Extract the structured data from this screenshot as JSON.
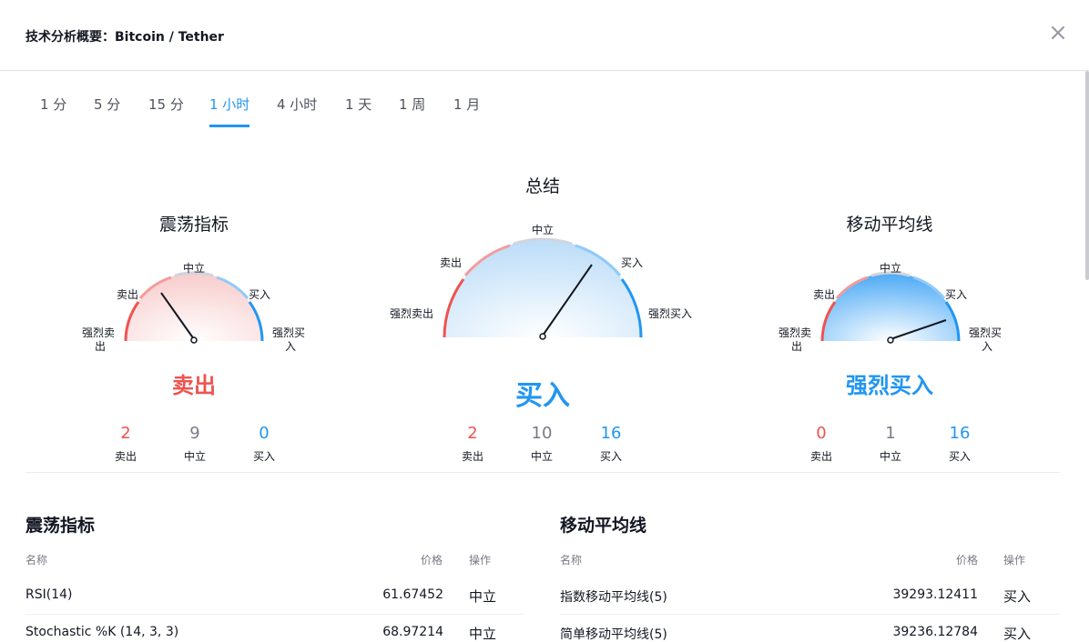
{
  "header": {
    "title": "技术分析概要：Bitcoin / Tether"
  },
  "tabs": [
    {
      "label": "1 分",
      "active": false
    },
    {
      "label": "5 分",
      "active": false
    },
    {
      "label": "15 分",
      "active": false
    },
    {
      "label": "1 小时",
      "active": true
    },
    {
      "label": "4 小时",
      "active": false
    },
    {
      "label": "1 天",
      "active": false
    },
    {
      "label": "1 周",
      "active": false
    },
    {
      "label": "1 月",
      "active": false
    }
  ],
  "gauges": {
    "oscillators": {
      "title": "震荡指标",
      "labels": {
        "strong_sell": "强烈卖出",
        "sell": "卖出",
        "neutral": "中立",
        "buy": "买入",
        "strong_buy": "强烈买入"
      },
      "verdict": "卖出",
      "counts": [
        {
          "value": "2",
          "label": "卖出"
        },
        {
          "value": "9",
          "label": "中立"
        },
        {
          "value": "0",
          "label": "买入"
        }
      ]
    },
    "summary": {
      "title": "总结",
      "labels": {
        "strong_sell": "强烈卖出",
        "sell": "卖出",
        "neutral": "中立",
        "buy": "买入",
        "strong_buy": "强烈买入"
      },
      "verdict": "买入",
      "counts": [
        {
          "value": "2",
          "label": "卖出"
        },
        {
          "value": "10",
          "label": "中立"
        },
        {
          "value": "16",
          "label": "买入"
        }
      ]
    },
    "moving_averages": {
      "title": "移动平均线",
      "labels": {
        "strong_sell": "强烈卖出",
        "sell": "卖出",
        "neutral": "中立",
        "buy": "买入",
        "strong_buy": "强烈买入"
      },
      "verdict": "强烈买入",
      "counts": [
        {
          "value": "0",
          "label": "卖出"
        },
        {
          "value": "1",
          "label": "中立"
        },
        {
          "value": "16",
          "label": "买入"
        }
      ]
    }
  },
  "oscillators_table": {
    "title": "震荡指标",
    "columns": {
      "name": "名称",
      "price": "价格",
      "action": "操作"
    },
    "rows": [
      {
        "name": "RSI(14)",
        "price": "61.67452",
        "action": "中立"
      },
      {
        "name": "Stochastic %K (14, 3, 3)",
        "price": "68.97214",
        "action": "中立"
      }
    ]
  },
  "ma_table": {
    "title": "移动平均线",
    "columns": {
      "name": "名称",
      "price": "价格",
      "action": "操作"
    },
    "rows": [
      {
        "name": "指数移动平均线(5)",
        "price": "39293.12411",
        "action": "买入"
      },
      {
        "name": "简单移动平均线(5)",
        "price": "39236.12784",
        "action": "买入"
      }
    ]
  },
  "colors": {
    "sell": "#ef5350",
    "neutral": "#787b86",
    "buy": "#2196f3",
    "arc_neutral": "#d1d4dc"
  }
}
